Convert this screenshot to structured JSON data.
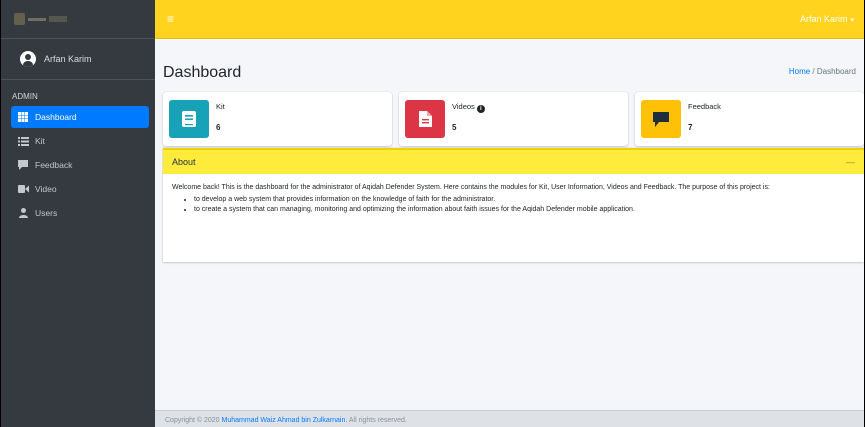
{
  "topbar": {
    "user": "Arfan Karim",
    "menu_glyph": "≡",
    "caret": "▾"
  },
  "sidebar": {
    "user_name": "Arfan Karim",
    "section": "ADMIN",
    "items": [
      {
        "label": "Dashboard",
        "icon": "grid-icon",
        "active": true
      },
      {
        "label": "Kit",
        "icon": "list-icon",
        "active": false
      },
      {
        "label": "Feedback",
        "icon": "comment-icon",
        "active": false
      },
      {
        "label": "Video",
        "icon": "video-icon",
        "active": false
      },
      {
        "label": "Users",
        "icon": "user-icon",
        "active": false
      }
    ]
  },
  "page": {
    "title": "Dashboard",
    "breadcrumb_home": "Home",
    "breadcrumb_sep": " / ",
    "breadcrumb_current": "Dashboard"
  },
  "info_boxes": [
    {
      "label": "Kit",
      "value": "6",
      "color": "#17a2b8",
      "icon": "book-icon"
    },
    {
      "label": "Videos",
      "value": "5",
      "color": "#dc3545",
      "icon": "file-icon"
    },
    {
      "label": "Feedback",
      "value": "7",
      "color": "#ffc107",
      "icon": "comment-icon"
    }
  ],
  "about": {
    "title": "About",
    "collapse": "—",
    "intro": "Welcome back! This is the dashboard for the administrator of Aqidah Defender System. Here contains the modules for Kit, User Information, Videos and Feedback. The purpose of this project is:",
    "points": [
      "to develop a web system that provides information on the knowledge of faith for the administrator.",
      "to create a system that can managing, monitoring and optimizing the information about faith issues for the Aqidah Defender mobile application."
    ]
  },
  "footer": {
    "prefix": "Copyright © 2020 ",
    "author": "Muhammad Waiz Ahmad bin Zulkarnain.",
    "suffix": " All rights reserved."
  },
  "colors": {
    "sidebar": "#343a40",
    "topbar": "#ffd31e",
    "active": "#007bff",
    "about_header": "#ffeb3b"
  }
}
